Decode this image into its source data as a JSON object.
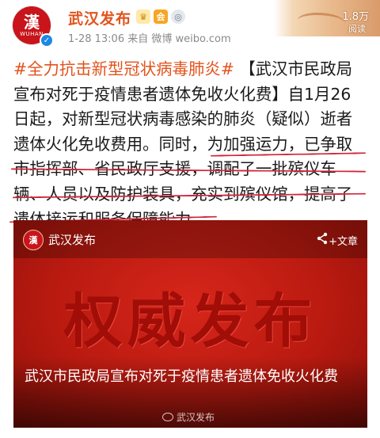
{
  "header": {
    "avatar_glyph": "漢",
    "avatar_sub": "WUHAN",
    "username": "武汉发布",
    "badges": {
      "vip": "♛",
      "member": "会",
      "medal": "◎"
    },
    "meta": "1-28 13:06  来自 微博 weibo.com"
  },
  "read_banner": {
    "count": "1.8万",
    "label": "阅读"
  },
  "post": {
    "lines": [
      {
        "hashtag": "#全力抗击新型冠状病毒肺炎#",
        "text": " 【武汉市民政局"
      },
      {
        "text": "宣布对死于疫情患者遗体免收火化费】自1月26"
      },
      {
        "text": "日起，对新型冠状病毒感染的肺炎（疑似）逝者"
      },
      {
        "text": "遗体火化免收费用。同时，为加强运力，已争取"
      },
      {
        "text": "市指挥部、省民政厅支援，调配了一批殡仪车"
      },
      {
        "text": "辆、人员以及防护装具，充实到殡仪馆，提高了"
      },
      {
        "text": "遗体接运和服务保障能力。"
      }
    ]
  },
  "card": {
    "source": "武汉发布",
    "avatar_glyph": "漢",
    "share_icon": "share-icon",
    "type_label": "+文章",
    "big_text": "权威发布",
    "title": "武汉市民政局宣布对死于疫情患者遗体免收火化费",
    "watermark": "武汉发布"
  },
  "colors": {
    "accent": "#e2531c",
    "underline": "#d1253a",
    "card_red": "#c01a10"
  }
}
